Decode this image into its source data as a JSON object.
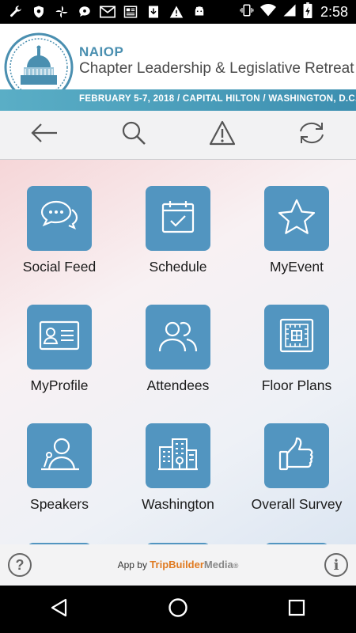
{
  "status_bar": {
    "time": "2:58",
    "left_icons": [
      "wrench-icon",
      "shield-icon",
      "pinwheel-icon",
      "chat-icon",
      "mail-icon",
      "news-icon",
      "download-icon",
      "warning-icon",
      "android-icon"
    ],
    "right_icons": [
      "vibrate-icon",
      "wifi-icon",
      "signal-icon",
      "battery-icon"
    ]
  },
  "header": {
    "brand": "NAIOP",
    "title": "Chapter Leadership & Legislative Retreat",
    "band_text": "FEBRUARY 5-7, 2018 / CAPITAL HILTON / WASHINGTON, D.C.",
    "accent_color": "#4a8fb0"
  },
  "toolbar": {
    "items": [
      "back-arrow-icon",
      "search-icon",
      "alert-icon",
      "refresh-icon"
    ]
  },
  "grid": {
    "tile_color": "#5295c0",
    "tiles": [
      {
        "label": "Social Feed",
        "icon": "chat-bubbles-icon"
      },
      {
        "label": "Schedule",
        "icon": "calendar-check-icon"
      },
      {
        "label": "MyEvent",
        "icon": "star-icon"
      },
      {
        "label": "MyProfile",
        "icon": "id-card-icon"
      },
      {
        "label": "Attendees",
        "icon": "people-icon"
      },
      {
        "label": "Floor Plans",
        "icon": "floor-plan-icon"
      },
      {
        "label": "Speakers",
        "icon": "speaker-podium-icon"
      },
      {
        "label": "Washington",
        "icon": "city-buildings-icon"
      },
      {
        "label": "Overall Survey",
        "icon": "thumbs-up-icon"
      }
    ]
  },
  "footer": {
    "credit_prefix": "App by",
    "credit_trip": "TripBuilder",
    "credit_media": "Media",
    "credit_mark": "®",
    "help_label": "?",
    "info_label": "i"
  },
  "navbar": {
    "items": [
      "back-triangle-icon",
      "home-circle-icon",
      "recents-square-icon"
    ]
  }
}
